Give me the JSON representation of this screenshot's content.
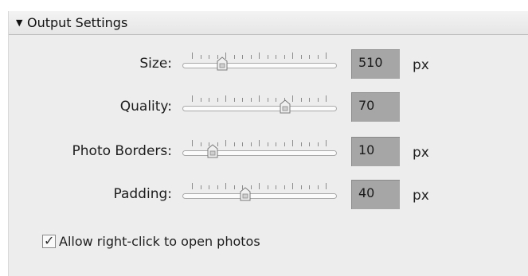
{
  "panel": {
    "title": "Output Settings",
    "collapse_icon": "triangle-down-icon"
  },
  "rows": [
    {
      "label": "Size:",
      "value": "510",
      "unit": "px",
      "slider_fraction": 0.22
    },
    {
      "label": "Quality:",
      "value": "70",
      "unit": "",
      "slider_fraction": 0.7
    },
    {
      "label": "Photo Borders:",
      "value": "10",
      "unit": "px",
      "slider_fraction": 0.15
    },
    {
      "label": "Padding:",
      "value": "40",
      "unit": "px",
      "slider_fraction": 0.4
    }
  ],
  "checkbox": {
    "label": "Allow right-click to open photos",
    "checked": true
  },
  "colors": {
    "panel_bg": "#ededed",
    "value_box": "#a6a6a6"
  }
}
